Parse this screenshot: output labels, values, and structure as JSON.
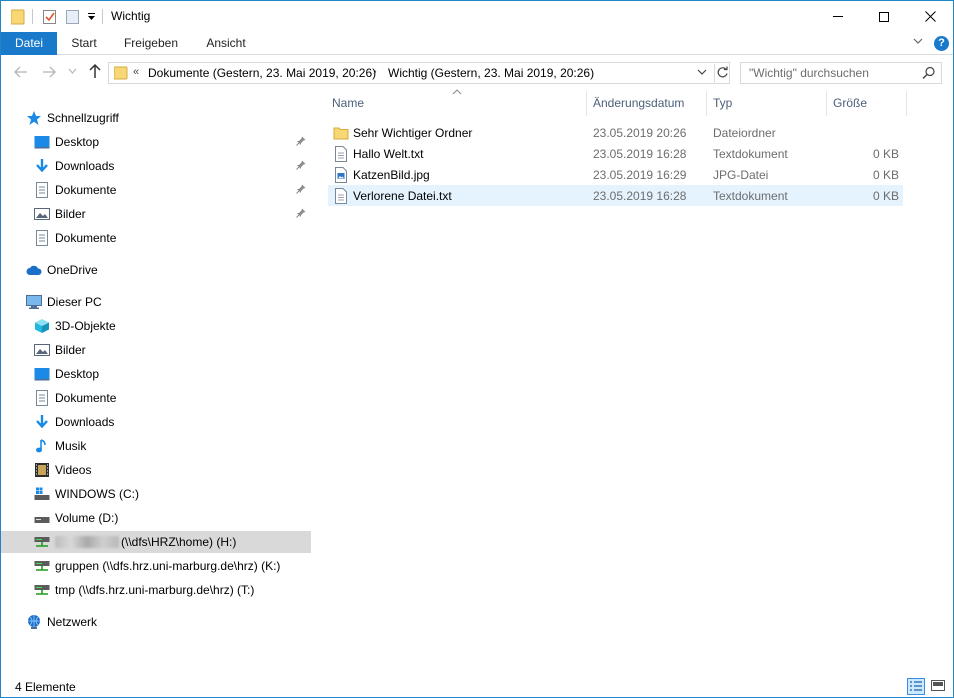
{
  "window": {
    "title": "Wichtig"
  },
  "ribbon": {
    "tabs": [
      {
        "label": "Datei"
      },
      {
        "label": "Start"
      },
      {
        "label": "Freigeben"
      },
      {
        "label": "Ansicht"
      }
    ],
    "help": "?"
  },
  "address": {
    "chevron": "«",
    "crumbs": [
      {
        "label": "Dokumente (Gestern, 23. Mai 2019, 20:26)"
      },
      {
        "label": "Wichtig (Gestern, 23. Mai 2019, 20:26)"
      }
    ],
    "separator": "›"
  },
  "search": {
    "placeholder": "\"Wichtig\" durchsuchen"
  },
  "sidebar": {
    "items": [
      {
        "label": "Schnellzugriff",
        "icon": "star-icon"
      },
      {
        "label": "Desktop",
        "icon": "desktop-icon",
        "pinned": true
      },
      {
        "label": "Downloads",
        "icon": "download-icon",
        "pinned": true
      },
      {
        "label": "Dokumente",
        "icon": "document-icon",
        "pinned": true
      },
      {
        "label": "Bilder",
        "icon": "pictures-icon",
        "pinned": true
      },
      {
        "label": "Dokumente",
        "icon": "document-icon",
        "pinned": false
      },
      {
        "label": "OneDrive",
        "icon": "cloud-icon"
      },
      {
        "label": "Dieser PC",
        "icon": "computer-icon"
      },
      {
        "label": "3D-Objekte",
        "icon": "cube-icon"
      },
      {
        "label": "Bilder",
        "icon": "pictures-icon"
      },
      {
        "label": "Desktop",
        "icon": "desktop-icon"
      },
      {
        "label": "Dokumente",
        "icon": "document-icon"
      },
      {
        "label": "Downloads",
        "icon": "download-icon"
      },
      {
        "label": "Musik",
        "icon": "music-icon"
      },
      {
        "label": "Videos",
        "icon": "video-icon"
      },
      {
        "label": "WINDOWS (C:)",
        "icon": "windows-drive-icon"
      },
      {
        "label": "Volume (D:)",
        "icon": "drive-icon"
      },
      {
        "label": "(\\\\dfs\\HRZ\\home) (H:)",
        "icon": "network-drive-icon",
        "selected": true
      },
      {
        "label": "gruppen (\\\\dfs.hrz.uni-marburg.de\\hrz) (K:)",
        "icon": "network-drive-icon"
      },
      {
        "label": "tmp (\\\\dfs.hrz.uni-marburg.de\\hrz) (T:)",
        "icon": "network-drive-icon"
      },
      {
        "label": "Netzwerk",
        "icon": "network-icon"
      }
    ]
  },
  "columns": {
    "name": "Name",
    "date": "Änderungsdatum",
    "type": "Typ",
    "size": "Größe"
  },
  "files": [
    {
      "name": "Sehr Wichtiger Ordner",
      "date": "23.05.2019 20:26",
      "type": "Dateiordner",
      "size": "",
      "icon": "folder-icon"
    },
    {
      "name": "Hallo Welt.txt",
      "date": "23.05.2019 16:28",
      "type": "Textdokument",
      "size": "0 KB",
      "icon": "text-file-icon"
    },
    {
      "name": "KatzenBild.jpg",
      "date": "23.05.2019 16:29",
      "type": "JPG-Datei",
      "size": "0 KB",
      "icon": "image-file-icon"
    },
    {
      "name": "Verlorene Datei.txt",
      "date": "23.05.2019 16:28",
      "type": "Textdokument",
      "size": "0 KB",
      "icon": "text-file-icon",
      "selected": true
    }
  ],
  "status": {
    "count": "4 Elemente"
  },
  "colors": {
    "accent": "#1979ca",
    "selection": "#e5f3ff",
    "sidebar_selection": "#d9d9d9",
    "folder": "#f8d775"
  }
}
